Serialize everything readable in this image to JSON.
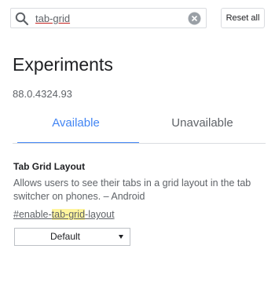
{
  "search": {
    "value": "tab-grid",
    "placeholder": "Search flags"
  },
  "toolbar": {
    "reset_label": "Reset all"
  },
  "header": {
    "title": "Experiments",
    "version": "88.0.4324.93"
  },
  "tabs": [
    {
      "label": "Available",
      "selected": true
    },
    {
      "label": "Unavailable",
      "selected": false
    }
  ],
  "experiment": {
    "title": "Tab Grid Layout",
    "description": "Allows users to see their tabs in a grid layout in the tab switcher on phones. – Android",
    "link_prefix": "#enable-",
    "link_match": "tab-grid",
    "link_suffix": "-layout",
    "select_value": "Default"
  },
  "colors": {
    "accent": "#4285f4",
    "highlight": "#fff59d"
  },
  "icons": {
    "search": "search-icon",
    "clear": "clear-icon",
    "dropdown": "dropdown-arrow-icon"
  }
}
